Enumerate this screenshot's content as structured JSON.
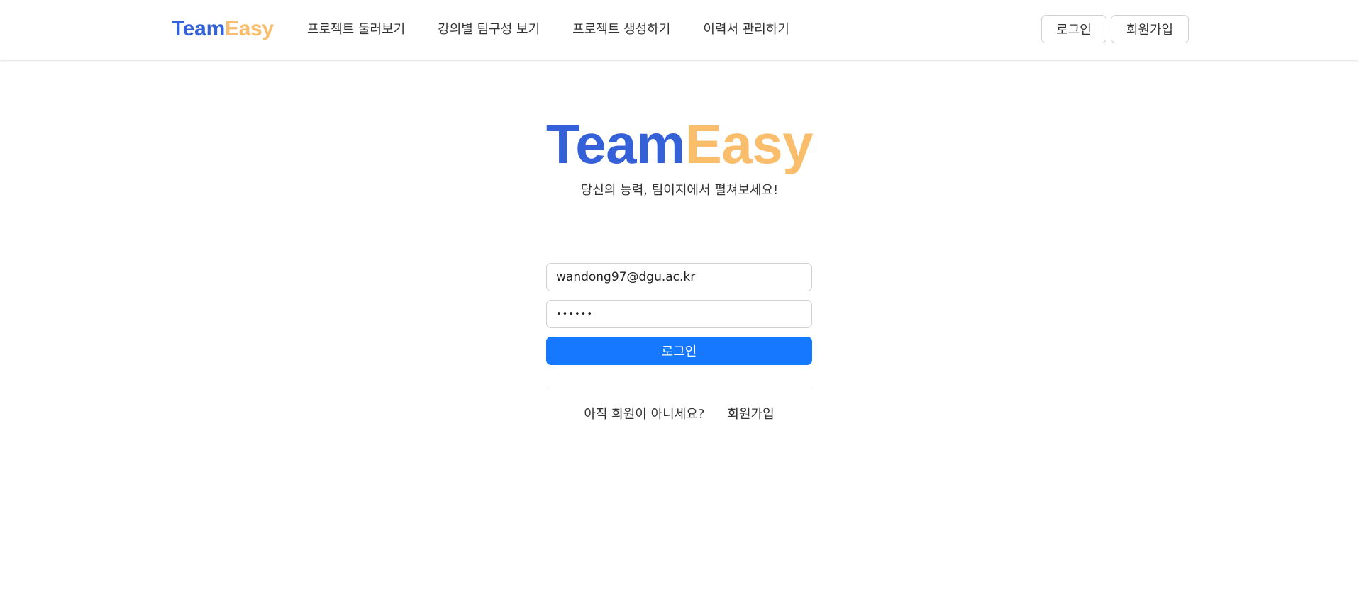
{
  "header": {
    "brand": {
      "part1": "Team",
      "part2": "Easy"
    },
    "nav": [
      {
        "label": "프로젝트 둘러보기"
      },
      {
        "label": "강의별 팀구성 보기"
      },
      {
        "label": "프로젝트 생성하기"
      },
      {
        "label": "이력서 관리하기"
      }
    ],
    "login_label": "로그인",
    "signup_label": "회원가입"
  },
  "main": {
    "logo": {
      "part1": "Team",
      "part2": "Easy"
    },
    "tagline": "당신의 능력, 팀이지에서 펼쳐보세요!",
    "form": {
      "email_value": "wandong97@dgu.ac.kr",
      "password_value": "••••••",
      "submit_label": "로그인"
    },
    "signup_prompt": "아직 회원이 아니세요?",
    "signup_link": "회원가입"
  },
  "colors": {
    "brand_blue": "#3561d8",
    "brand_orange": "#f9bd6b",
    "primary": "#1677ff"
  }
}
